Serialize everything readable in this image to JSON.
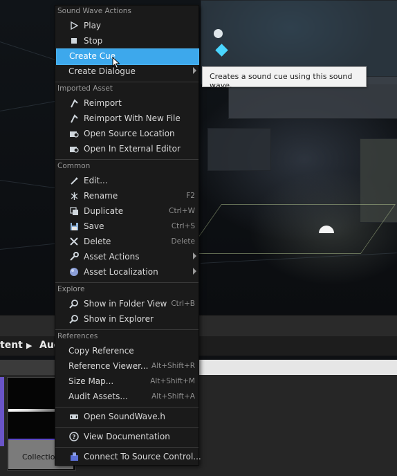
{
  "menu": {
    "sections": {
      "sound_wave_actions": "Sound Wave Actions",
      "imported_asset": "Imported Asset",
      "common": "Common",
      "explore": "Explore",
      "references": "References"
    },
    "items": {
      "play": "Play",
      "stop": "Stop",
      "create_cue": "Create Cue",
      "create_dialogue": "Create Dialogue",
      "reimport": "Reimport",
      "reimport_with_new_file": "Reimport With New File",
      "open_source_location": "Open Source Location",
      "open_in_external_editor": "Open In External Editor",
      "edit": "Edit...",
      "rename": "Rename",
      "rename_shortcut": "F2",
      "duplicate": "Duplicate",
      "duplicate_shortcut": "Ctrl+W",
      "save": "Save",
      "save_shortcut": "Ctrl+S",
      "delete": "Delete",
      "delete_shortcut": "Delete",
      "asset_actions": "Asset Actions",
      "asset_localization": "Asset Localization",
      "show_in_folder_view": "Show in Folder View",
      "show_in_folder_view_shortcut": "Ctrl+B",
      "show_in_explorer": "Show in Explorer",
      "copy_reference": "Copy Reference",
      "reference_viewer": "Reference Viewer...",
      "reference_viewer_shortcut": "Alt+Shift+R",
      "size_map": "Size Map...",
      "size_map_shortcut": "Alt+Shift+M",
      "audit_assets": "Audit Assets...",
      "audit_assets_shortcut": "Alt+Shift+A",
      "open_soundwave_h": "Open SoundWave.h",
      "view_documentation": "View Documentation",
      "connect_to_source_control": "Connect To Source Control..."
    }
  },
  "tooltip": {
    "text": "Creates a sound cue using this sound wave."
  },
  "content_browser": {
    "breadcrumb_1": "tent",
    "breadcrumb_2": "Aud",
    "asset_label": "Collection"
  },
  "colors": {
    "highlight": "#3da8ec",
    "menu_bg": "#1a1a1a"
  }
}
